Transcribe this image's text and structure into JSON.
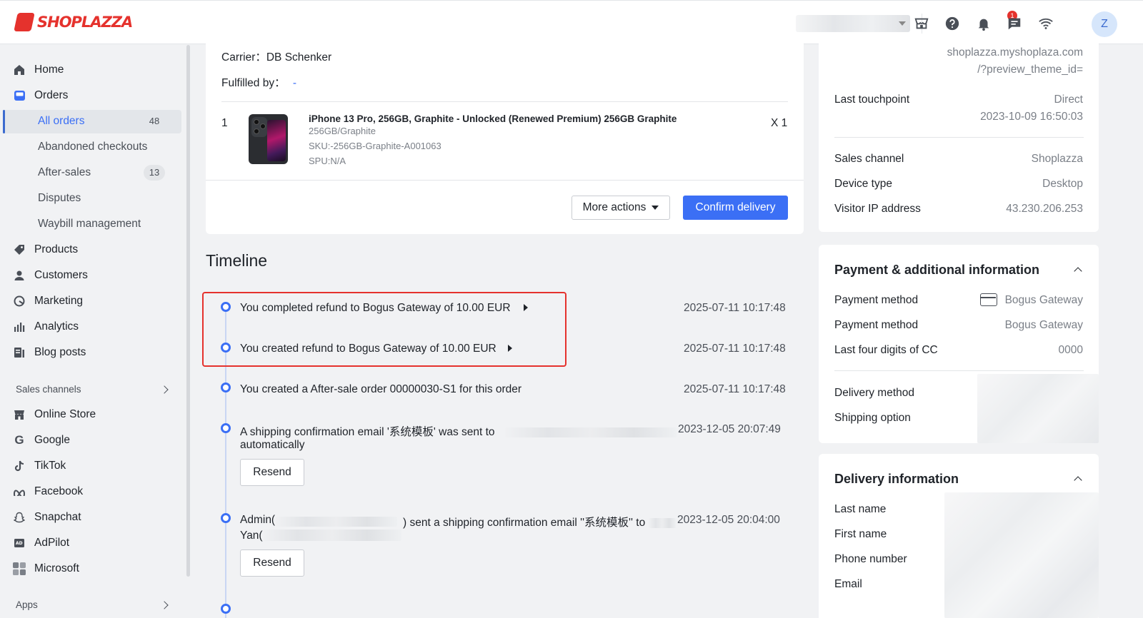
{
  "brand": {
    "name": "SHOPLAZZA",
    "color": "#e5322d"
  },
  "topbar": {
    "icons": [
      "store-icon",
      "help-icon",
      "bell-icon",
      "chat-icon",
      "wifi-icon"
    ],
    "notification_count": "1",
    "avatar_initial": "Z"
  },
  "sidebar": {
    "home": "Home",
    "orders": "Orders",
    "all_orders": "All orders",
    "all_orders_count": "48",
    "abandoned": "Abandoned checkouts",
    "after_sales": "After-sales",
    "after_sales_count": "13",
    "disputes": "Disputes",
    "waybill": "Waybill management",
    "products": "Products",
    "customers": "Customers",
    "marketing": "Marketing",
    "analytics": "Analytics",
    "blog_posts": "Blog posts",
    "sales_channels": "Sales channels",
    "online_store": "Online Store",
    "google": "Google",
    "tiktok": "TikTok",
    "facebook": "Facebook",
    "snapchat": "Snapchat",
    "adpilot": "AdPilot",
    "microsoft": "Microsoft",
    "apps": "Apps"
  },
  "fulfillment": {
    "carrier": "Carrier：DB Schenker",
    "fulfilled_by_label": "Fulfilled by：",
    "fulfilled_by_value": "-",
    "item_index": "1",
    "product_title": "iPhone 13 Pro, 256GB, Graphite - Unlocked (Renewed Premium) 256GB Graphite",
    "variant": "256GB/Graphite",
    "sku": "SKU:-256GB-Graphite-A001063",
    "spu": "SPU:N/A",
    "quantity": "X 1",
    "more_actions": "More actions",
    "confirm_delivery": "Confirm delivery"
  },
  "timeline": {
    "title": "Timeline",
    "highlight_color": "#e5322d",
    "events": [
      {
        "text": "You completed refund to Bogus Gateway of 10.00 EUR",
        "time": "2025-07-11 10:17:48"
      },
      {
        "text": "You created refund to Bogus Gateway of 10.00 EUR",
        "time": "2025-07-11 10:17:48"
      },
      {
        "text": "You created a After-sale order 00000030-S1 for this order",
        "time": "2025-07-11 10:17:48"
      },
      {
        "text": "A shipping confirmation email '系统模板' was sent to",
        "text2": "automatically",
        "time": "2023-12-05 20:07:49",
        "button": "Resend"
      },
      {
        "text": "Admin(",
        "text_mid": ") sent a shipping confirmation email ''系统模板'' to",
        "text2": "Yan(",
        "time": "2023-12-05 20:04:00",
        "button": "Resend"
      }
    ]
  },
  "session": {
    "landing_url_1": "shoplazza.myshoplaza.com",
    "landing_url_2": "/?preview_theme_id=",
    "last_touchpoint_label": "Last touchpoint",
    "last_touchpoint_value": "Direct",
    "last_touchpoint_time": "2023-10-09 16:50:03",
    "sales_channel_label": "Sales channel",
    "sales_channel_value": "Shoplazza",
    "device_type_label": "Device type",
    "device_type_value": "Desktop",
    "visitor_ip_label": "Visitor IP address",
    "visitor_ip_value": "43.230.206.253"
  },
  "payment": {
    "title": "Payment & additional information",
    "method_label": "Payment method",
    "method_value": "Bogus Gateway",
    "method2_label": "Payment method",
    "method2_value": "Bogus Gateway",
    "cc_label": "Last four digits of CC",
    "cc_value": "0000",
    "delivery_method_label": "Delivery method",
    "shipping_option_label": "Shipping option"
  },
  "delivery": {
    "title": "Delivery information",
    "last_name": "Last name",
    "first_name": "First name",
    "phone": "Phone number",
    "email": "Email"
  }
}
